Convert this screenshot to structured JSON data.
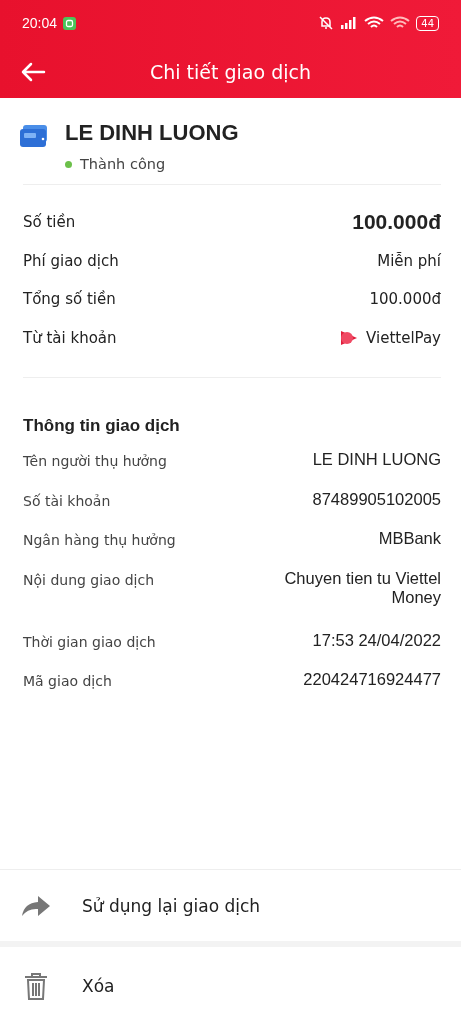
{
  "status_bar": {
    "time": "20:04",
    "battery": "44"
  },
  "header": {
    "title": "Chi tiết giao dịch"
  },
  "recipient": {
    "name": "LE DINH LUONG",
    "status": "Thành công"
  },
  "summary": [
    {
      "label": "Số tiền",
      "value": "100.000đ",
      "kind": "amount"
    },
    {
      "label": "Phí giao dịch",
      "value": "Miễn phí",
      "kind": "plain"
    },
    {
      "label": "Tổng số tiền",
      "value": "100.000đ",
      "kind": "plain"
    },
    {
      "label": "Từ tài khoản",
      "value": "ViettelPay",
      "kind": "account"
    }
  ],
  "details": {
    "title": "Thông tin giao dịch",
    "rows": [
      {
        "label": "Tên người thụ hưởng",
        "value": "LE DINH LUONG"
      },
      {
        "label": "Số tài khoản",
        "value": "87489905102005"
      },
      {
        "label": "Ngân hàng thụ hưởng",
        "value": "MBBank"
      },
      {
        "label": "Nội dung giao dịch",
        "value": "Chuyen tien tu Viettel Money"
      },
      {
        "label": "Thời gian giao dịch",
        "value": "17:53 24/04/2022"
      },
      {
        "label": "Mã giao dịch",
        "value": "220424716924477"
      }
    ]
  },
  "actions": [
    {
      "label": "Sử dụng lại giao dịch",
      "kind": "reuse"
    },
    {
      "label": "Xóa",
      "kind": "delete"
    }
  ]
}
